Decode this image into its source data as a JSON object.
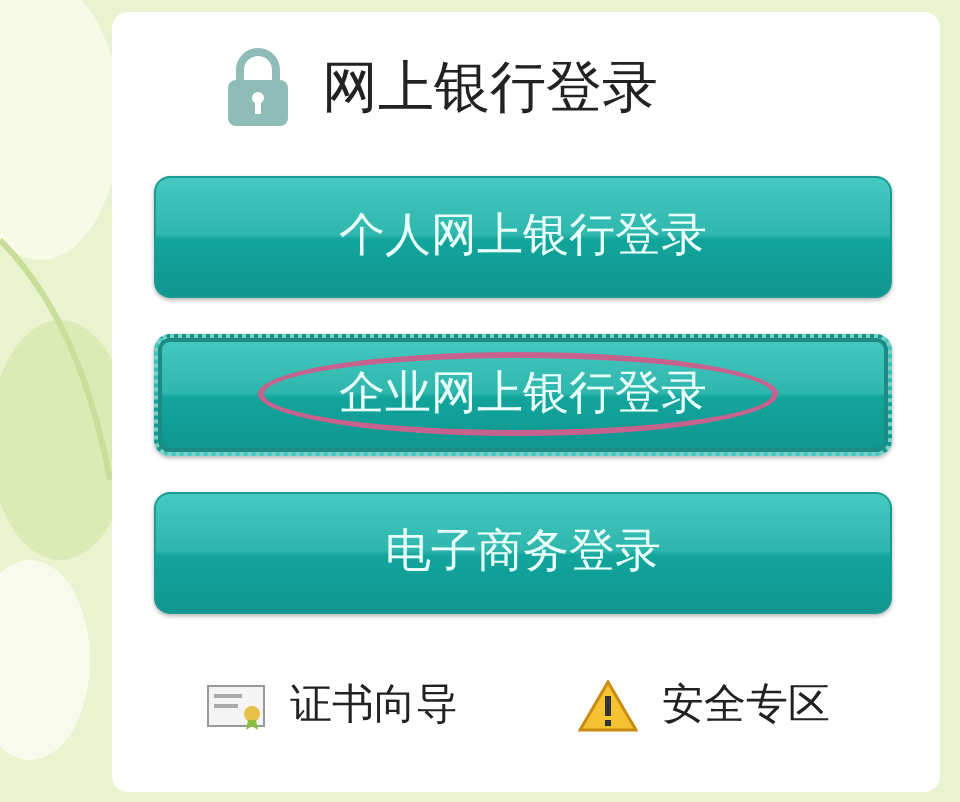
{
  "title": "网上银行登录",
  "buttons": [
    {
      "label": "个人网上银行登录",
      "highlighted": false
    },
    {
      "label": "企业网上银行登录",
      "highlighted": true
    },
    {
      "label": "电子商务登录",
      "highlighted": false
    }
  ],
  "links": [
    {
      "label": "证书向导",
      "kind": "certificate"
    },
    {
      "label": "安全专区",
      "kind": "warning"
    }
  ]
}
